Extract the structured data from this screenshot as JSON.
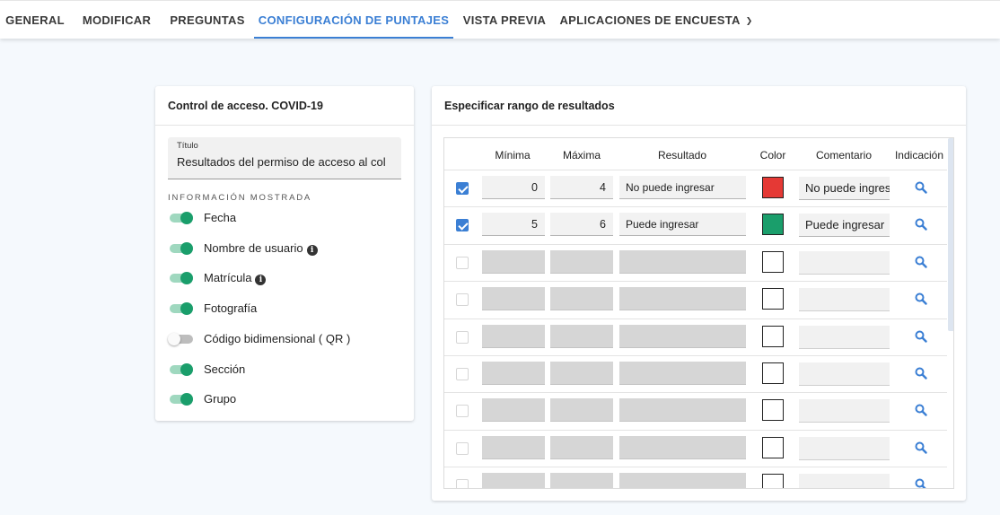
{
  "tabs": [
    {
      "label": "GENERAL",
      "active": false
    },
    {
      "label": "MODIFICAR",
      "active": false
    },
    {
      "label": "PREGUNTAS",
      "active": false
    },
    {
      "label": "CONFIGURACIÓN DE PUNTAJES",
      "active": true
    },
    {
      "label": "VISTA PREVIA",
      "active": false
    },
    {
      "label": "APLICACIONES DE ENCUESTA",
      "active": false,
      "dropdown": true
    }
  ],
  "left_card": {
    "heading": "Control de acceso. COVID-19",
    "title_field": {
      "label": "Título",
      "value": "Resultados del permiso de acceso al col"
    },
    "section_label": "INFORMACIÓN MOSTRADA",
    "toggles": [
      {
        "label": "Fecha",
        "on": true,
        "info": false
      },
      {
        "label": "Nombre de usuario",
        "on": true,
        "info": true
      },
      {
        "label": "Matrícula",
        "on": true,
        "info": true
      },
      {
        "label": "Fotografía",
        "on": true,
        "info": false
      },
      {
        "label": "Código bidimensional ( QR )",
        "on": false,
        "info": false
      },
      {
        "label": "Sección",
        "on": true,
        "info": false
      },
      {
        "label": "Grupo",
        "on": true,
        "info": false
      }
    ],
    "info_glyph": "i"
  },
  "right_card": {
    "heading": "Especificar rango de resultados",
    "columns": [
      "Mínima",
      "Máxima",
      "Resultado",
      "Color",
      "Comentario",
      "Indicación"
    ],
    "rows": [
      {
        "checked": true,
        "min": "0",
        "max": "4",
        "result": "No puede ingresar",
        "color": "#e53935",
        "comment": "No puede ingresar",
        "filled": true
      },
      {
        "checked": true,
        "min": "5",
        "max": "6",
        "result": "Puede ingresar",
        "color": "#1a9e6b",
        "comment": "Puede ingresar",
        "filled": true
      },
      {
        "checked": false,
        "min": "",
        "max": "",
        "result": "",
        "color": "#ffffff",
        "comment": "",
        "filled": false
      },
      {
        "checked": false,
        "min": "",
        "max": "",
        "result": "",
        "color": "#ffffff",
        "comment": "",
        "filled": false
      },
      {
        "checked": false,
        "min": "",
        "max": "",
        "result": "",
        "color": "#ffffff",
        "comment": "",
        "filled": false
      },
      {
        "checked": false,
        "min": "",
        "max": "",
        "result": "",
        "color": "#ffffff",
        "comment": "",
        "filled": false
      },
      {
        "checked": false,
        "min": "",
        "max": "",
        "result": "",
        "color": "#ffffff",
        "comment": "",
        "filled": false
      },
      {
        "checked": false,
        "min": "",
        "max": "",
        "result": "",
        "color": "#ffffff",
        "comment": "",
        "filled": false
      },
      {
        "checked": false,
        "min": "",
        "max": "",
        "result": "",
        "color": "#ffffff",
        "comment": "",
        "filled": false
      }
    ],
    "indication_icon": "magnifier-icon"
  },
  "colors": {
    "accent": "#3b7fd4",
    "toggle_on": "#1a9e6b"
  }
}
